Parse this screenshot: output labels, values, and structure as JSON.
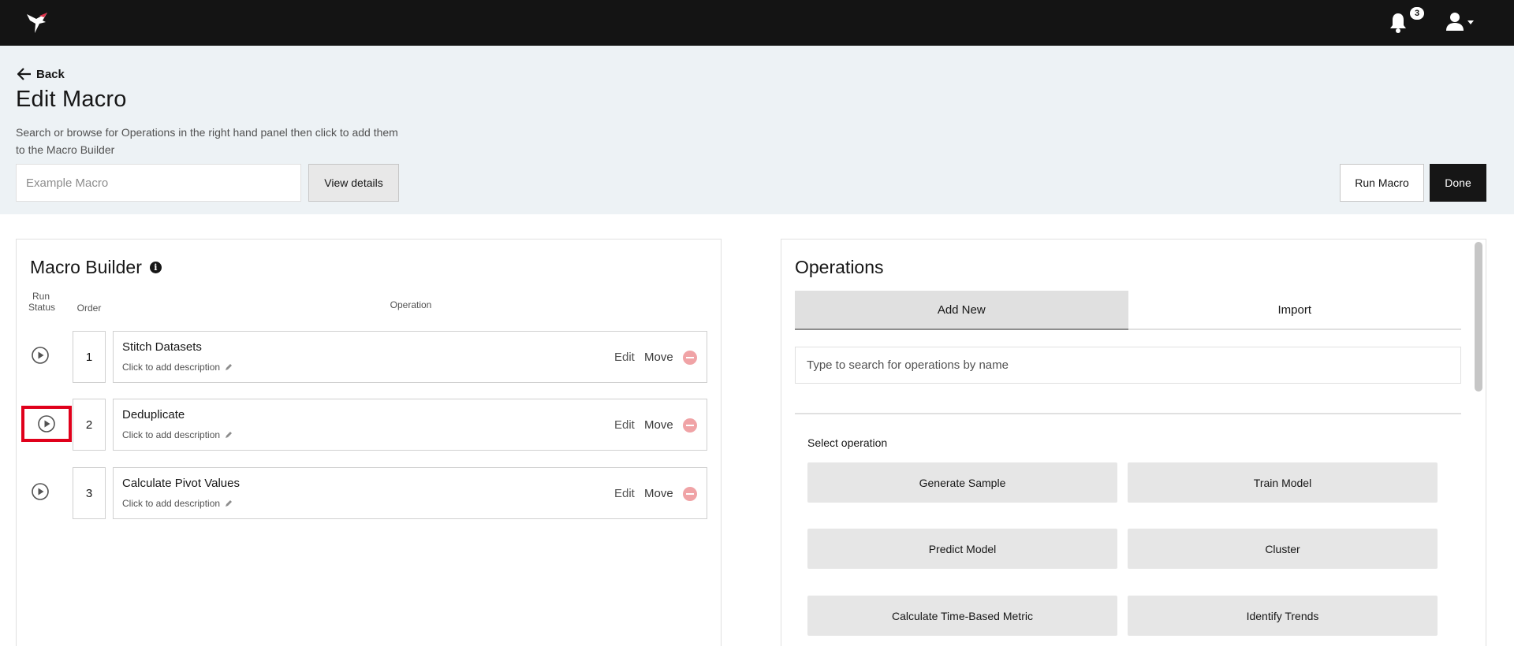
{
  "topbar": {
    "notification_count": "3"
  },
  "header": {
    "back_label": "Back",
    "title": "Edit Macro",
    "description": "Search or browse for Operations in the right hand panel then click to add them to the Macro Builder",
    "macro_name_placeholder": "Example Macro",
    "view_details_label": "View details",
    "run_macro_label": "Run Macro",
    "done_label": "Done"
  },
  "macro_builder": {
    "title": "Macro Builder",
    "col_run_status": "Run Status",
    "col_order": "Order",
    "col_operation": "Operation",
    "rows": [
      {
        "order": "1",
        "name": "Stitch Datasets",
        "description": "Click to add description",
        "edit": "Edit",
        "move": "Move"
      },
      {
        "order": "2",
        "name": "Deduplicate",
        "description": "Click to add description",
        "edit": "Edit",
        "move": "Move"
      },
      {
        "order": "3",
        "name": "Calculate Pivot Values",
        "description": "Click to add description",
        "edit": "Edit",
        "move": "Move"
      }
    ]
  },
  "operations": {
    "title": "Operations",
    "tabs": [
      "Add New",
      "Import"
    ],
    "active_tab": "Add New",
    "search_placeholder": "Type to search for operations by name",
    "select_label": "Select operation",
    "buttons": [
      "Generate Sample",
      "Train Model",
      "Predict Model",
      "Cluster",
      "Calculate Time-Based Metric",
      "Identify Trends"
    ]
  },
  "colors": {
    "topbar": "#141414",
    "header_bg": "#edf2f5",
    "done_button": "#161616",
    "remove_icon": "#f0a3a6",
    "highlight_box": "#e0001b"
  }
}
